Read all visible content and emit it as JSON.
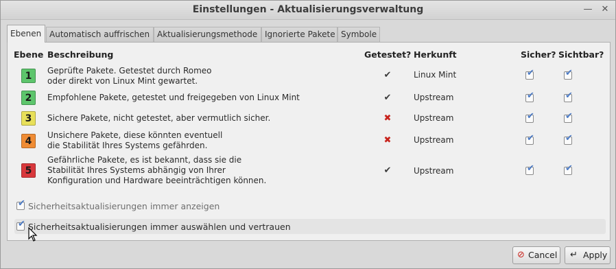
{
  "window": {
    "title": "Einstellungen - Aktualisierungsverwaltung",
    "minimize_icon": "minimize-icon",
    "close_icon": "close-icon"
  },
  "tabs": [
    {
      "label": "Ebenen",
      "active": true
    },
    {
      "label": "Automatisch auffrischen",
      "active": false
    },
    {
      "label": "Aktualisierungsmethode",
      "active": false
    },
    {
      "label": "Ignorierte Pakete",
      "active": false
    },
    {
      "label": "Symbole",
      "active": false
    }
  ],
  "table": {
    "headers": {
      "level": "Ebene",
      "description": "Beschreibung",
      "tested": "Getestet?",
      "origin": "Herkunft",
      "safe": "Sicher?",
      "visible": "Sichtbar?"
    },
    "rows": [
      {
        "level": "1",
        "color": "#5dc56c",
        "desc": [
          "Geprüfte Pakete. Getestet durch Romeo",
          "oder direkt von Linux Mint gewartet."
        ],
        "tested": true,
        "origin": "Linux Mint",
        "safe": true,
        "visible": true
      },
      {
        "level": "2",
        "color": "#5dc56c",
        "desc": [
          "Empfohlene Pakete, getestet und freigegeben von Linux Mint"
        ],
        "tested": true,
        "origin": "Upstream",
        "safe": true,
        "visible": true
      },
      {
        "level": "3",
        "color": "#e8e05a",
        "desc": [
          "Sichere Pakete, nicht getestet, aber vermutlich sicher."
        ],
        "tested": false,
        "origin": "Upstream",
        "safe": true,
        "visible": true
      },
      {
        "level": "4",
        "color": "#f08c34",
        "desc": [
          "Unsichere Pakete, diese könnten eventuell",
          "die Stabilität Ihres Systems gefährden."
        ],
        "tested": false,
        "origin": "Upstream",
        "safe": true,
        "visible": true
      },
      {
        "level": "5",
        "color": "#d9383c",
        "desc": [
          "Gefährliche Pakete, es ist bekannt, dass sie die",
          "Stabilität Ihres Systems abhängig von Ihrer",
          "Konfiguration und Hardware beeinträchtigen können."
        ],
        "tested": true,
        "origin": "Upstream",
        "safe": true,
        "visible": true
      }
    ]
  },
  "options": {
    "always_show": {
      "label": "Sicherheitsaktualisierungen immer anzeigen",
      "checked": true
    },
    "always_select": {
      "label": "Sicherheitsaktualisierungen immer auswählen und vertrauen",
      "checked": true
    }
  },
  "buttons": {
    "cancel": {
      "label": "Cancel",
      "icon": "cancel-icon"
    },
    "apply": {
      "label": "Apply",
      "icon": "apply-icon"
    }
  },
  "colors": {
    "check_blue": "#4a79c4",
    "cross_red": "#c8231c"
  }
}
